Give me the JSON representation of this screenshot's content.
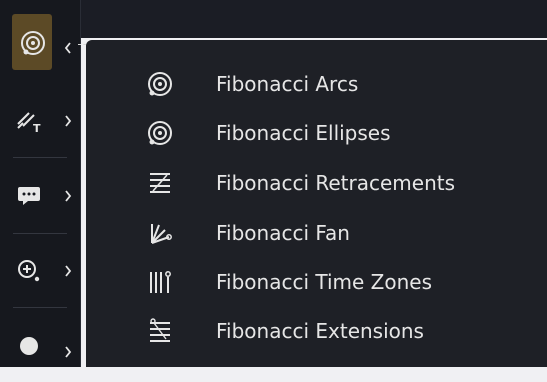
{
  "colors": {
    "toolbar_bg": "#16181e",
    "menu_bg": "#1e2026",
    "active_bg": "#5c4a26",
    "text": "#e6e6e6",
    "icon": "#e6e6e6"
  },
  "toolbar": {
    "tools": [
      {
        "name": "fibonacci-tools",
        "icon": "fib-arc-icon",
        "active": true
      },
      {
        "name": "text-annotation-tools",
        "icon": "pen-text-icon",
        "active": false
      },
      {
        "name": "comment-tools",
        "icon": "speech-bubble-icon",
        "active": false
      },
      {
        "name": "measure-zoom-tools",
        "icon": "zoom-plus-icon",
        "active": false
      },
      {
        "name": "dot-tools",
        "icon": "dot-icon",
        "active": false
      }
    ]
  },
  "menu": {
    "items": [
      {
        "label": "Fibonacci Arcs",
        "icon": "fib-arcs-icon"
      },
      {
        "label": "Fibonacci Ellipses",
        "icon": "fib-ellipses-icon"
      },
      {
        "label": "Fibonacci Retracements",
        "icon": "fib-retracement-icon"
      },
      {
        "label": "Fibonacci Fan",
        "icon": "fib-fan-icon"
      },
      {
        "label": "Fibonacci Time Zones",
        "icon": "fib-time-zones-icon"
      },
      {
        "label": "Fibonacci Extensions",
        "icon": "fib-extensions-icon"
      }
    ]
  }
}
